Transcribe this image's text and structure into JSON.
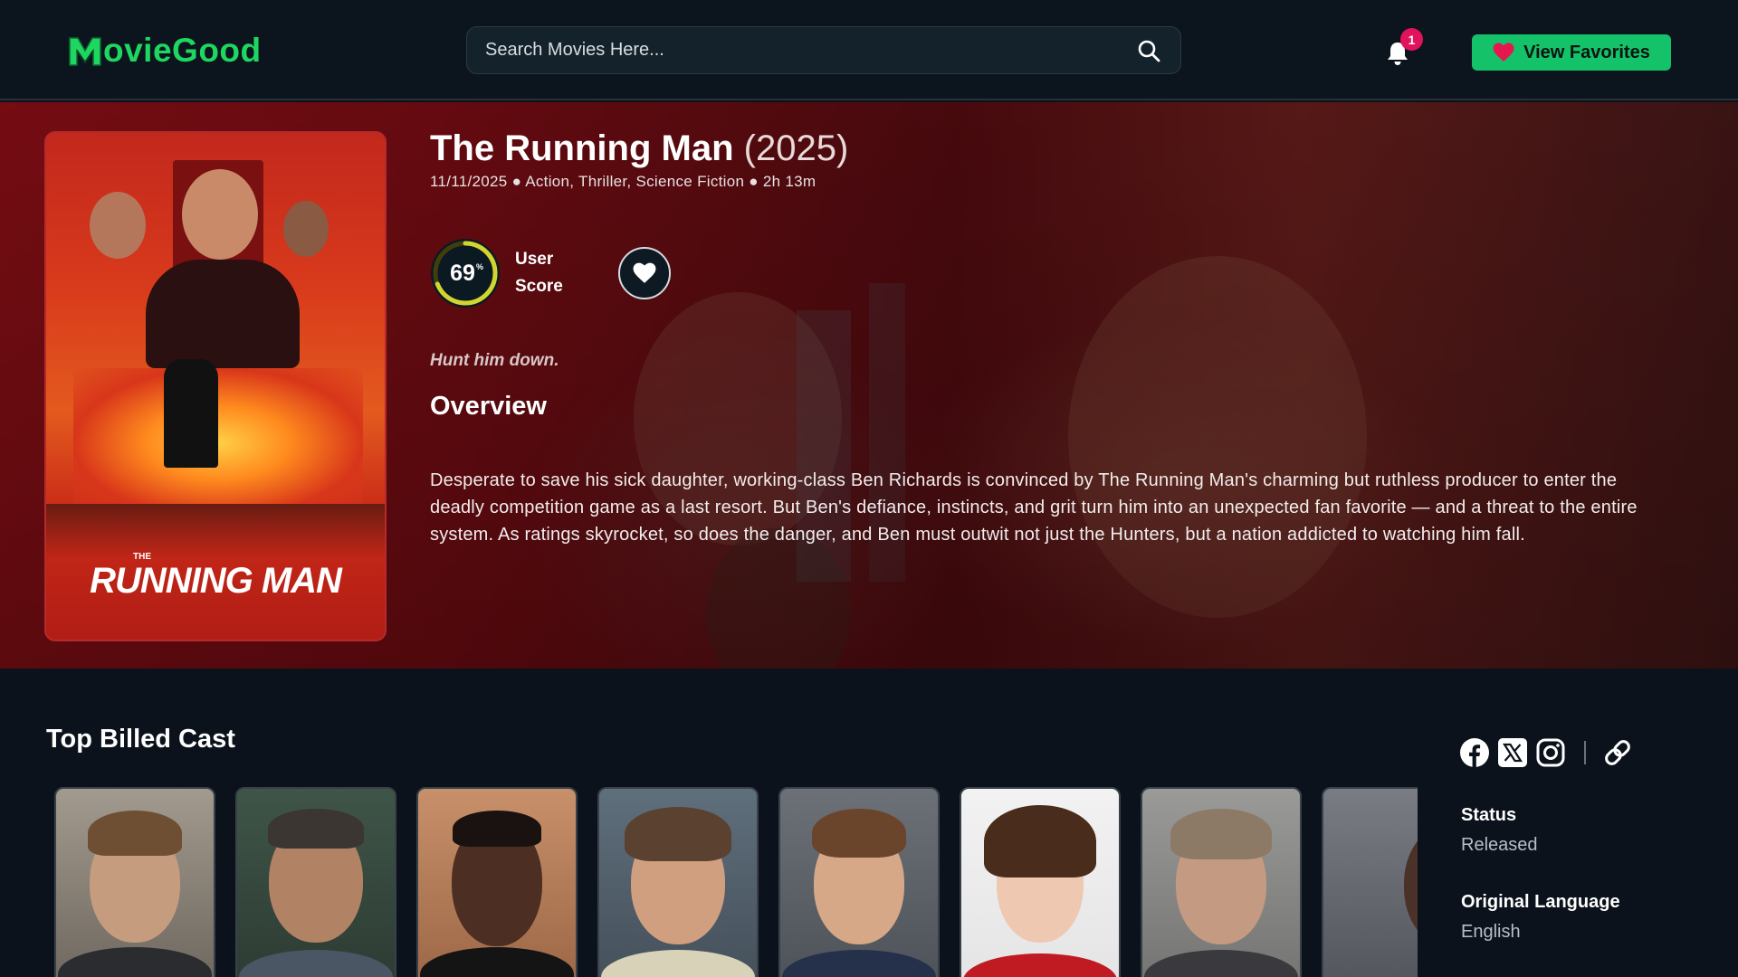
{
  "header": {
    "logo_text": "ovieGood",
    "search_placeholder": "Search Movies Here...",
    "notification_count": "1",
    "favorites_label": "View Favorites",
    "accent_color": "#14c26a"
  },
  "movie": {
    "title": "The Running Man",
    "year": "(2025)",
    "meta": "11/11/2025 ● Action, Thriller, Science Fiction ● 2h 13m",
    "user_score": 69,
    "user_score_text": "69",
    "user_score_unit": "%",
    "score_label_line1": "User",
    "score_label_line2": "Score",
    "tagline": "Hunt him down.",
    "overview_heading": "Overview",
    "overview": "Desperate to save his sick daughter, working-class Ben Richards is convinced by The Running Man's charming but ruthless producer to enter the deadly competition game as a last resort. But Ben's defiance, instincts, and grit turn him into an unexpected fan favorite — and a threat to the entire system. As ratings skyrocket, so does the danger, and Ben must outwit not just the Hunters, but a nation addicted to watching him fall.",
    "poster_title": "RUNNING MAN",
    "poster_the": "THE"
  },
  "cast": {
    "heading": "Top Billed Cast"
  },
  "sidebar": {
    "status_label": "Status",
    "status_value": "Released",
    "language_label": "Original Language",
    "language_value": "English",
    "social_icons": [
      "facebook-icon",
      "x-icon",
      "instagram-icon",
      "link-icon"
    ]
  }
}
